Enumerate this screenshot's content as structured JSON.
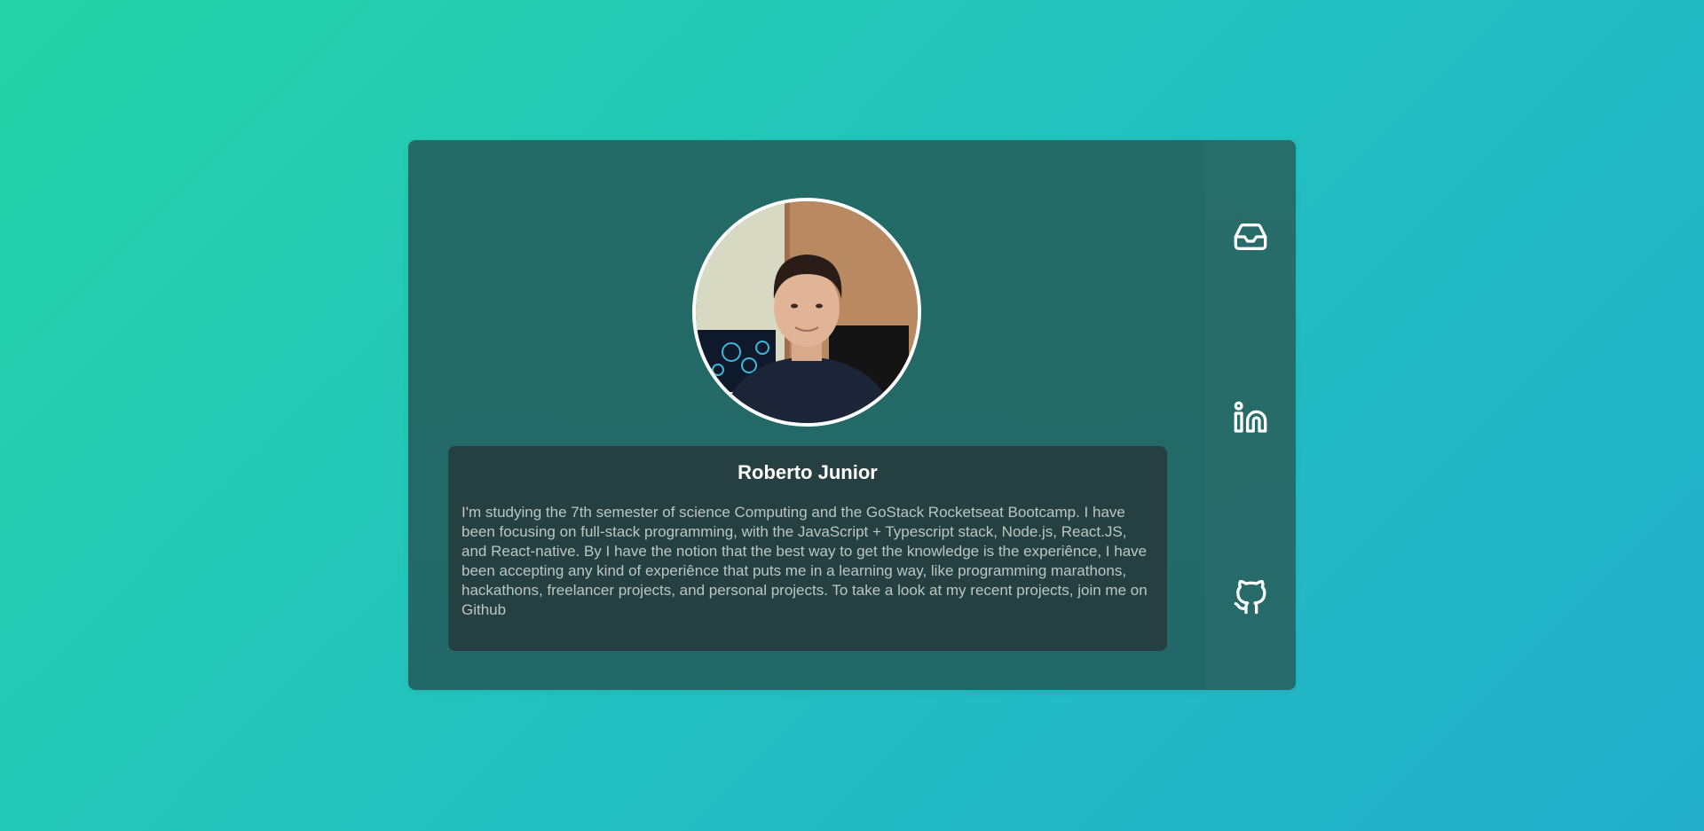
{
  "profile": {
    "name": "Roberto Junior",
    "bio": "I'm studying the 7th semester of science Computing and the GoStack Rocketseat Bootcamp. I have been focusing on full-stack programming, with the JavaScript + Typescript stack, Node.js, React.JS, and React-native. By I have the notion that the best way to get the knowledge is the experiênce, I have been accepting any kind of experiênce that puts me in a learning way, like programming marathons, hackathons, freelancer projects, and personal projects. To take a look at my recent projects, join me on Github"
  },
  "sidebar": {
    "items": [
      {
        "icon": "inbox-icon"
      },
      {
        "icon": "linkedin-icon"
      },
      {
        "icon": "github-icon"
      }
    ]
  },
  "colors": {
    "background_start": "#25d4a6",
    "background_end": "#22aecb",
    "card": "#236b66",
    "info_box": "#263f41",
    "name_text": "#ffffff",
    "bio_text": "#b9c7c6"
  }
}
